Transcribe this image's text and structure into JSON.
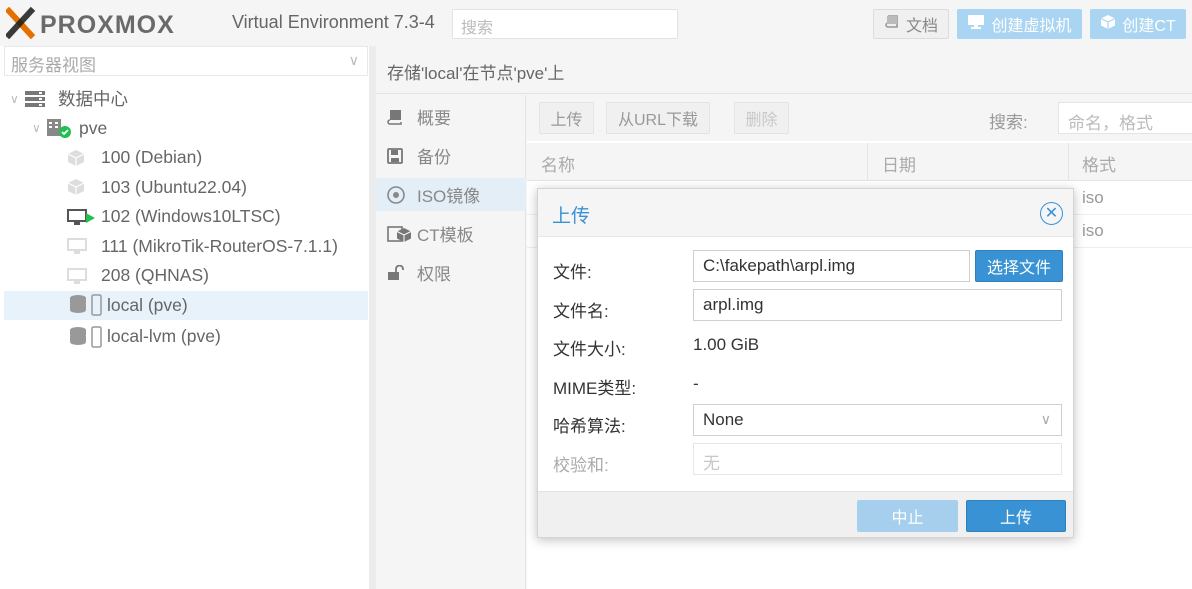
{
  "header": {
    "brand": "PROXMOX",
    "version": "Virtual Environment 7.3-4",
    "search_placeholder": "搜索",
    "docs_label": "文档",
    "create_vm_label": "创建虚拟机",
    "create_ct_label": "创建CT"
  },
  "sidebar": {
    "view_select": "服务器视图",
    "tree": [
      {
        "label": "数据中心",
        "icon": "datacenter-icon"
      },
      {
        "label": "pve",
        "icon": "node-online-icon"
      },
      {
        "label": "100 (Debian)",
        "icon": "container-icon"
      },
      {
        "label": "103 (Ubuntu22.04)",
        "icon": "container-icon"
      },
      {
        "label": "102 (Windows10LTSC)",
        "icon": "vm-running-icon"
      },
      {
        "label": "111 (MikroTik-RouterOS-7.1.1)",
        "icon": "vm-icon"
      },
      {
        "label": "208 (QHNAS)",
        "icon": "vm-icon"
      },
      {
        "label": "local (pve)",
        "icon": "storage-icon",
        "selected": true
      },
      {
        "label": "local-lvm (pve)",
        "icon": "storage-icon"
      }
    ]
  },
  "content": {
    "title": "存储'local'在节点'pve'上",
    "nav": [
      {
        "label": "概要",
        "icon": "book-icon"
      },
      {
        "label": "备份",
        "icon": "floppy-icon"
      },
      {
        "label": "ISO镜像",
        "icon": "disc-icon",
        "selected": true
      },
      {
        "label": "CT模板",
        "icon": "template-icon"
      },
      {
        "label": "权限",
        "icon": "unlock-icon"
      }
    ],
    "toolbar": {
      "upload": "上传",
      "download_url": "从URL下载",
      "delete": "删除",
      "search_label": "搜索:",
      "search_placeholder": "命名，格式"
    },
    "grid": {
      "columns": [
        "名称",
        "日期",
        "格式"
      ],
      "rows": [
        {
          "format": "iso"
        },
        {
          "format": "iso"
        }
      ]
    }
  },
  "dialog": {
    "title": "上传",
    "file_label": "文件:",
    "file_value": "C:\\fakepath\\arpl.img",
    "choose_file": "选择文件",
    "filename_label": "文件名:",
    "filename_value": "arpl.img",
    "size_label": "文件大小:",
    "size_value": "1.00 GiB",
    "mime_label": "MIME类型:",
    "mime_value": "-",
    "hash_label": "哈希算法:",
    "hash_value": "None",
    "checksum_label": "校验和:",
    "checksum_placeholder": "无",
    "abort": "中止",
    "upload": "上传"
  },
  "colors": {
    "accent": "#3892d4",
    "accent_light": "#a9d4f2",
    "logo_orange": "#e57000",
    "selection": "#e8f2fb"
  }
}
